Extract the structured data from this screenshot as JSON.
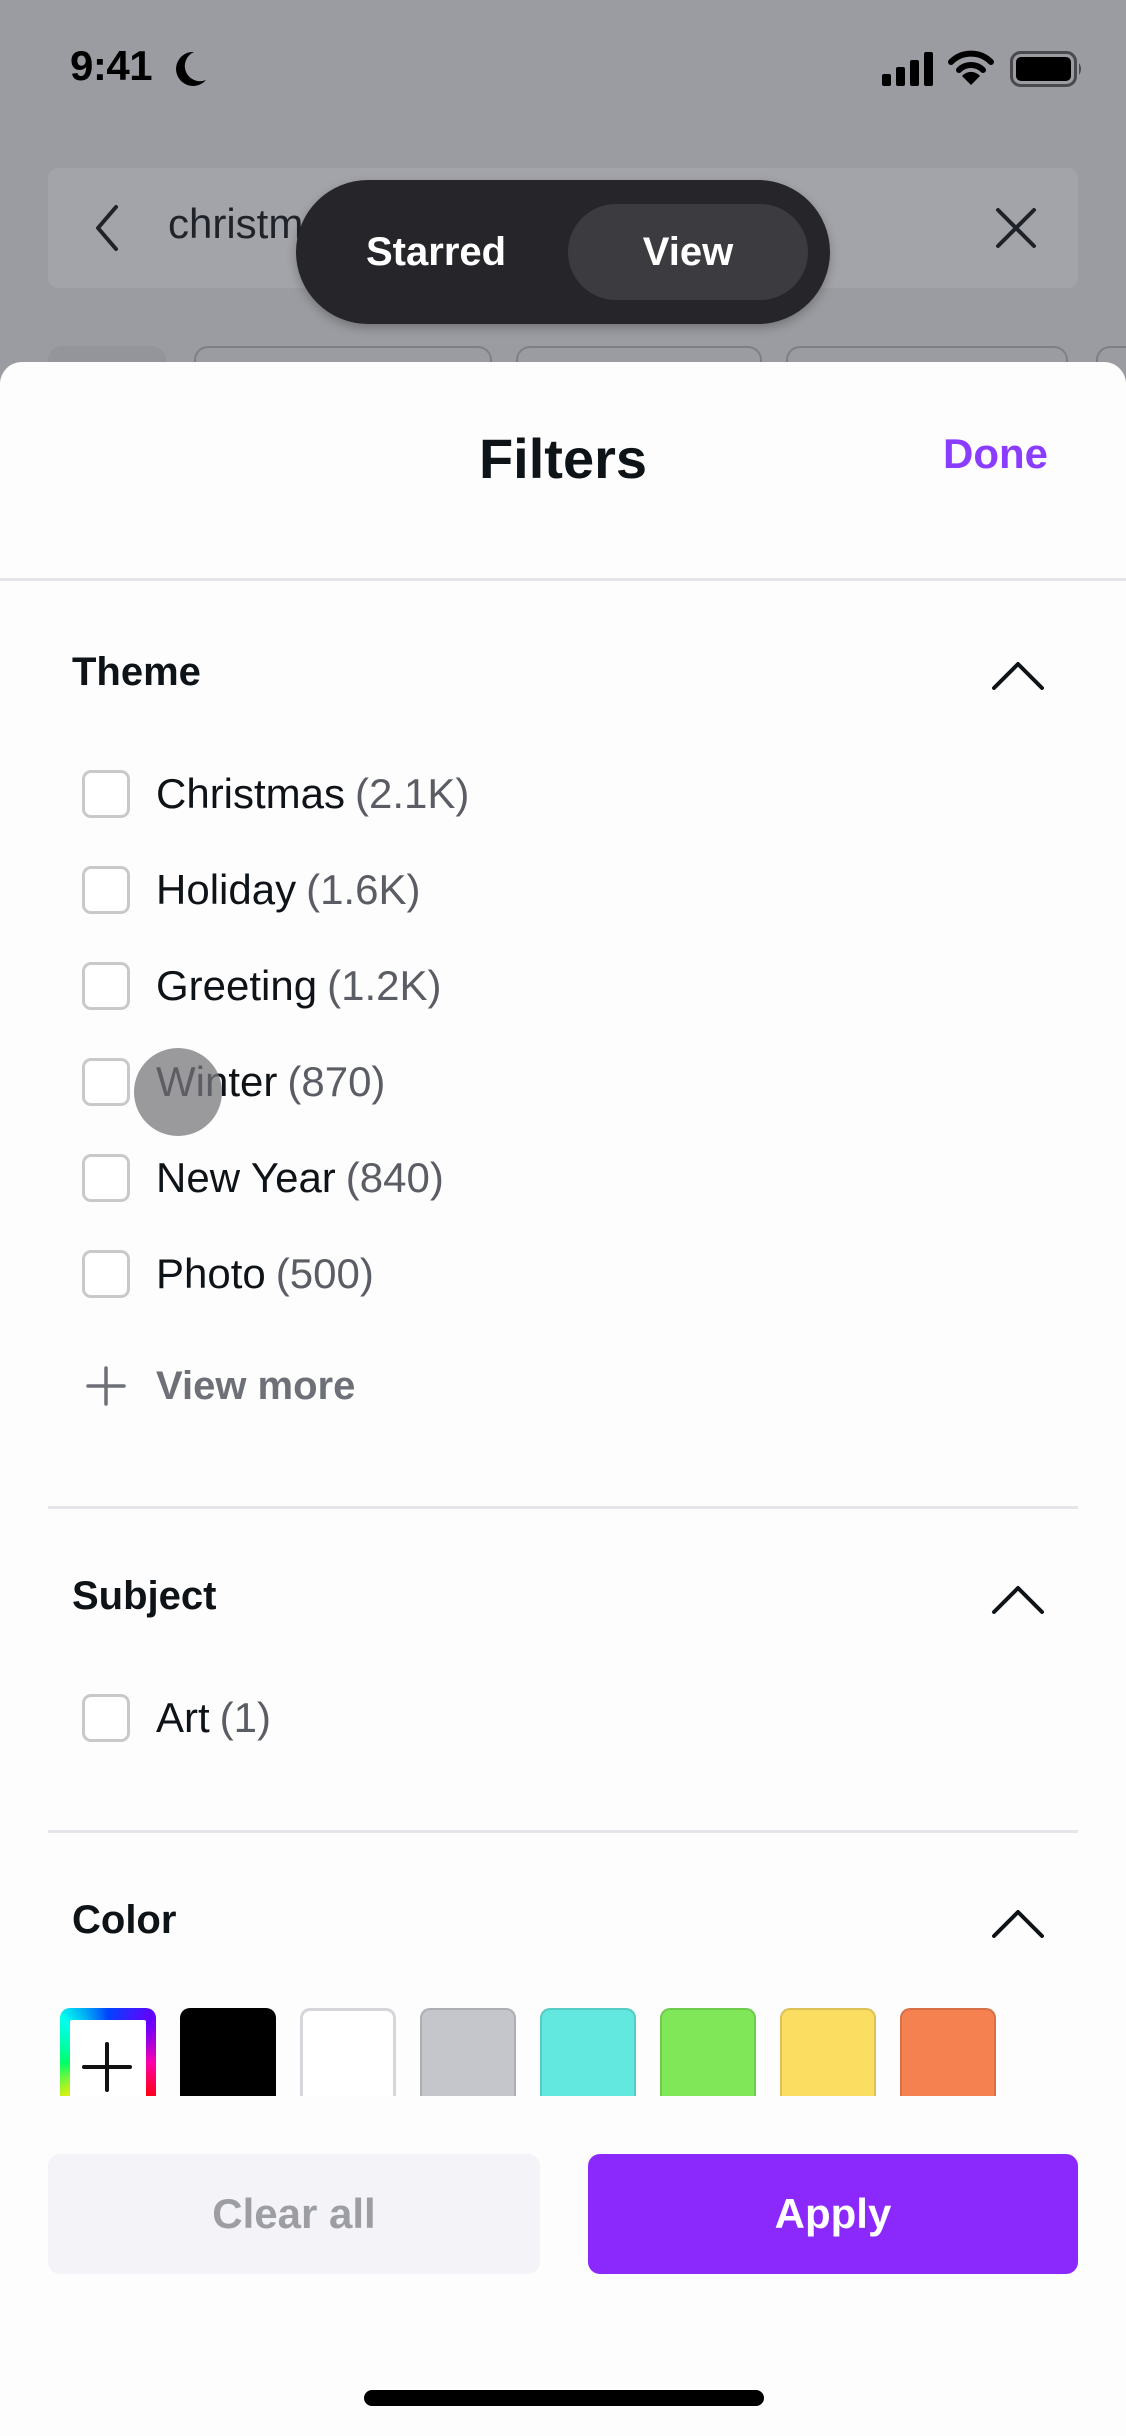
{
  "status_bar": {
    "time": "9:41",
    "icons": [
      "moon-icon",
      "signal-icon",
      "wifi-icon",
      "battery-icon"
    ]
  },
  "search": {
    "query": "christmas",
    "visible_query": "christm",
    "back_icon": "chevron-left-icon",
    "clear_icon": "close-icon"
  },
  "toast": {
    "label": "Starred",
    "action": "View"
  },
  "sheet": {
    "title": "Filters",
    "done_label": "Done",
    "accent_color": "#8b3dff"
  },
  "sections": {
    "theme": {
      "title": "Theme",
      "expanded": true,
      "options": [
        {
          "label": "Christmas",
          "count": "(2.1K)",
          "checked": false
        },
        {
          "label": "Holiday",
          "count": "(1.6K)",
          "checked": false
        },
        {
          "label": "Greeting",
          "count": "(1.2K)",
          "checked": false
        },
        {
          "label": "Winter",
          "count": "(870)",
          "checked": false
        },
        {
          "label": "New Year",
          "count": "(840)",
          "checked": false
        },
        {
          "label": "Photo",
          "count": "(500)",
          "checked": false
        }
      ],
      "view_more_label": "View more"
    },
    "subject": {
      "title": "Subject",
      "expanded": true,
      "options": [
        {
          "label": "Art",
          "count": "(1)",
          "checked": false
        }
      ]
    },
    "color": {
      "title": "Color",
      "expanded": true,
      "custom_picker": "add-color-icon",
      "swatches": [
        {
          "name": "black",
          "hex": "#000000"
        },
        {
          "name": "white",
          "hex": "#ffffff"
        },
        {
          "name": "gray",
          "hex": "#c5c6cc"
        },
        {
          "name": "turquoise",
          "hex": "#62e8df"
        },
        {
          "name": "green",
          "hex": "#7fe758"
        },
        {
          "name": "yellow",
          "hex": "#fbdd62"
        },
        {
          "name": "orange",
          "hex": "#f58050"
        }
      ]
    }
  },
  "footer": {
    "clear_label": "Clear all",
    "apply_label": "Apply",
    "apply_color": "#8b28fb"
  }
}
